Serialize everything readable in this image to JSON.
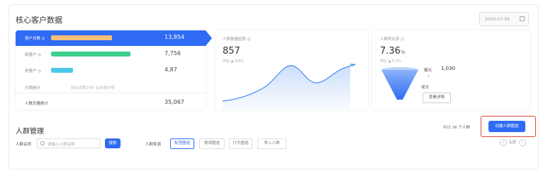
{
  "header": {
    "title": "核心客户数据",
    "date": "2024-07-04"
  },
  "metrics": [
    {
      "label": "客户总数 ◎",
      "value": "13,854",
      "color": "#f5c07a",
      "fill": 0.55,
      "active": true
    },
    {
      "label": "新客户 ◎",
      "value": "7,756",
      "color": "#3ecf8e",
      "fill": 0.72,
      "active": false
    },
    {
      "label": "老客户 ◎",
      "value": "4,87",
      "color": "#4cc9e6",
      "fill": 0.2,
      "active": false
    },
    {
      "label": "分类统计",
      "value": "",
      "tags": "新会员数分析  会员数分析",
      "active": false
    }
  ],
  "metrics_footer": {
    "label": "人数总量统计",
    "value": "35,067"
  },
  "card_trend": {
    "title": "人群数量趋势 ◎",
    "value": "857",
    "sub": "环比  ▲ 4.8%"
  },
  "card_funnel": {
    "title": "人群转化率 ◎",
    "value": "7.36",
    "unit": "%",
    "sub": "环比  ▲ 0.3%",
    "step1_label": "曝光",
    "step1_value": "1,030",
    "step2_label": "成交",
    "button": "查看详情"
  },
  "crowd": {
    "section_title": "人群管理",
    "info": "共计 36 个人群",
    "create_button": "创建人群圈选",
    "filter_name_label": "人群名称",
    "search_placeholder": "请输入人群名称",
    "search_button": "搜索",
    "source_label": "人群来源",
    "sources": [
      {
        "label": "标签圈选",
        "active": true
      },
      {
        "label": "规则圈选",
        "active": false
      },
      {
        "label": "行为圈选",
        "active": false
      },
      {
        "label": "导入人群",
        "active": false
      }
    ],
    "pager": "1/3"
  }
}
